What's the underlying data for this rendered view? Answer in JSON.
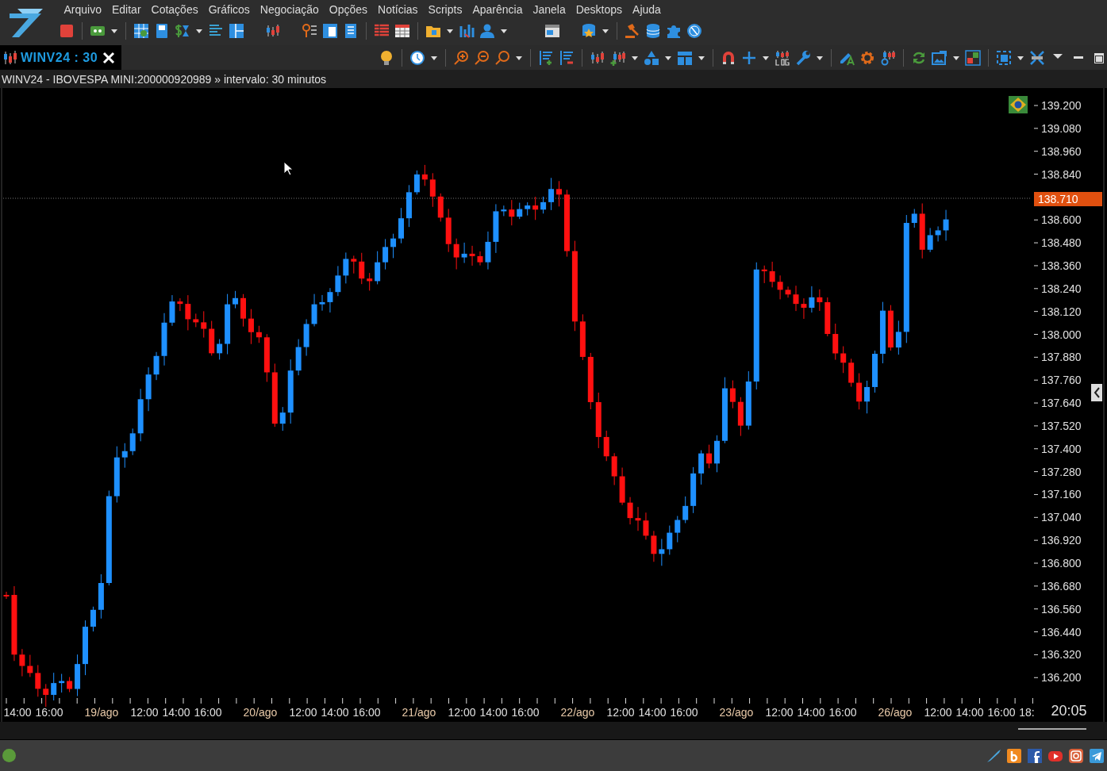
{
  "menu": [
    {
      "label": "Arquivo"
    },
    {
      "label": "Editar"
    },
    {
      "label": "Cotações"
    },
    {
      "label": "Gráficos"
    },
    {
      "label": "Negociação"
    },
    {
      "label": "Opções"
    },
    {
      "label": "Notícias"
    },
    {
      "label": "Scripts"
    },
    {
      "label": "Aparência"
    },
    {
      "label": "Janela"
    },
    {
      "label": "Desktops"
    },
    {
      "label": "Ajuda"
    }
  ],
  "chart_tab": {
    "label": "WINV24 : 30",
    "selected": true
  },
  "chart": {
    "info": "WINV24 - IBOVESPA MINI:200000920989 » intervalo: 30 minutos",
    "price_labels": [
      "139.200",
      "139.080",
      "138.960",
      "138.840",
      "138.600",
      "138.480",
      "138.360",
      "138.240",
      "138.120",
      "138.000",
      "137.880",
      "137.760",
      "137.640",
      "137.520",
      "137.400",
      "137.280",
      "137.160",
      "137.040",
      "136.920",
      "136.800",
      "136.680",
      "136.560",
      "136.440",
      "136.320",
      "136.200"
    ],
    "last_price": "138.710",
    "time_labels": [
      {
        "text": "14:00",
        "kind": "time"
      },
      {
        "text": "16:00",
        "kind": "time"
      },
      {
        "text": "19/ago",
        "kind": "day"
      },
      {
        "text": "12:00",
        "kind": "time"
      },
      {
        "text": "14:00",
        "kind": "time"
      },
      {
        "text": "16:00",
        "kind": "time"
      },
      {
        "text": "20/ago",
        "kind": "day"
      },
      {
        "text": "12:00",
        "kind": "time"
      },
      {
        "text": "14:00",
        "kind": "time"
      },
      {
        "text": "16:00",
        "kind": "time"
      },
      {
        "text": "21/ago",
        "kind": "day"
      },
      {
        "text": "12:00",
        "kind": "time"
      },
      {
        "text": "14:00",
        "kind": "time"
      },
      {
        "text": "16:00",
        "kind": "time"
      },
      {
        "text": "22/ago",
        "kind": "day"
      },
      {
        "text": "12:00",
        "kind": "time"
      },
      {
        "text": "14:00",
        "kind": "time"
      },
      {
        "text": "16:00",
        "kind": "time"
      },
      {
        "text": "23/ago",
        "kind": "day"
      },
      {
        "text": "12:00",
        "kind": "time"
      },
      {
        "text": "14:00",
        "kind": "time"
      },
      {
        "text": "16:00",
        "kind": "time"
      },
      {
        "text": "26/ago",
        "kind": "day"
      },
      {
        "text": "12:00",
        "kind": "time"
      },
      {
        "text": "14:00",
        "kind": "time"
      },
      {
        "text": "16:00",
        "kind": "time"
      },
      {
        "text": "18:",
        "kind": "time"
      }
    ],
    "clock": "20:05"
  },
  "status_bar": {
    "connected": true
  }
}
